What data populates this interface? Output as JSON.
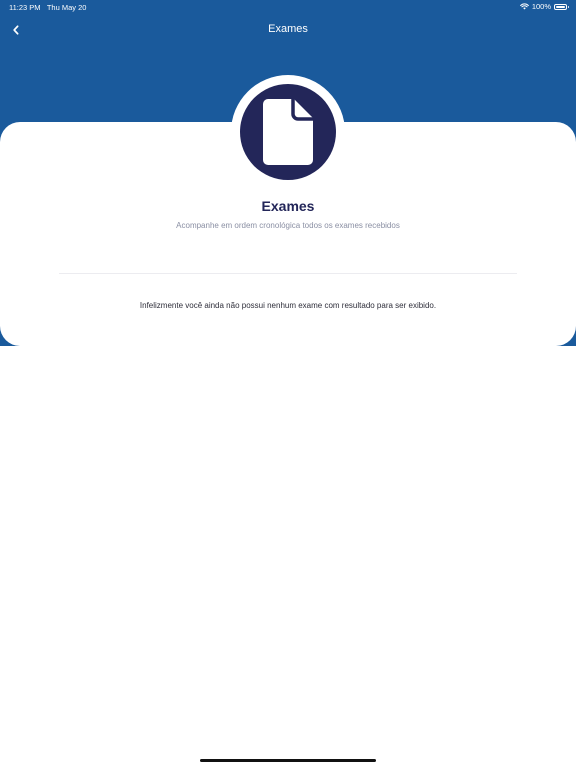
{
  "status_bar": {
    "time": "11:23 PM",
    "date": "Thu May 20",
    "battery": "100%",
    "battery_level": 1.0
  },
  "nav": {
    "title": "Exames",
    "back_icon": "chevron-left-icon"
  },
  "header": {
    "icon": "document-icon",
    "title": "Exames",
    "subtitle": "Acompanhe em ordem cronológica todos os exames recebidos"
  },
  "content": {
    "empty_message": "Infelizmente você ainda não possui nenhum exame com resultado para ser exibido."
  },
  "colors": {
    "header_blue": "#1a5a9c",
    "navy": "#232659",
    "subtitle_gray": "#8a8fa3",
    "background": "#ffffff"
  }
}
